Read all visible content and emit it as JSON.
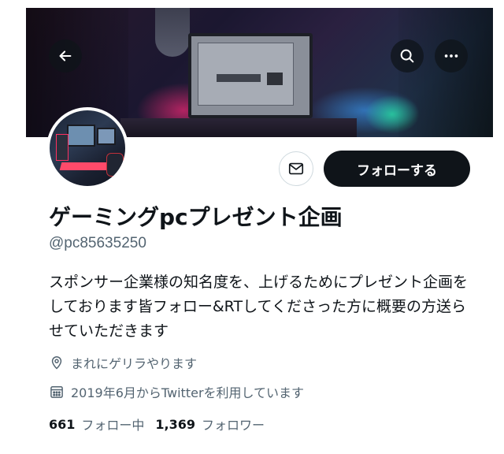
{
  "header": {
    "back_icon": "arrow-left-icon",
    "search_icon": "search-icon",
    "more_icon": "more-horizontal-icon"
  },
  "profile": {
    "display_name": "ゲーミングpcプレゼント企画",
    "handle": "@pc85635250",
    "bio": "スポンサー企業様の知名度を、上げるためにプレゼント企画をしております皆フォロー&RTしてくださった方に概要の方送らせていただきます",
    "location": "まれにゲリラやります",
    "joined": "2019年6月からTwitterを利用しています",
    "follow_label": "フォローする",
    "message_icon": "envelope-icon"
  },
  "stats": {
    "following_count": "661",
    "following_label": "フォロー中",
    "followers_count": "1,369",
    "followers_label": "フォロワー"
  },
  "colors": {
    "text_primary": "#0f1419",
    "text_secondary": "#536471",
    "button_dark": "#0f1419",
    "border": "#cfd9de"
  }
}
